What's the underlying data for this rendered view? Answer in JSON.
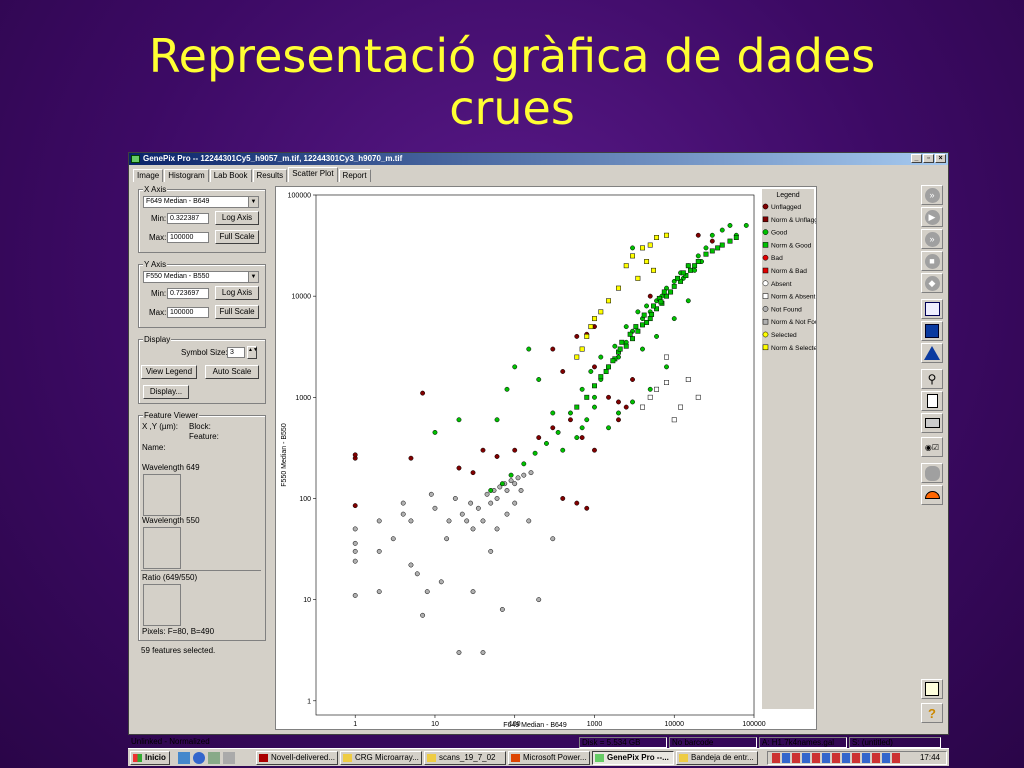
{
  "slide": {
    "title_line1": "Representació gràfica de dades",
    "title_line2": "crues"
  },
  "window": {
    "title": "GenePix Pro -- 12244301Cy5_h9057_m.tif, 12244301Cy3_h9070_m.tif",
    "min_label": "_",
    "max_label": "▫",
    "close_label": "×"
  },
  "tabs": [
    "Image",
    "Histogram",
    "Lab Book",
    "Results",
    "Scatter Plot",
    "Report"
  ],
  "active_tab": "Scatter Plot",
  "x_axis_group": {
    "label": "X Axis",
    "select": "F649 Median - B649",
    "min_label": "Min:",
    "min_value": "0.322387",
    "max_label": "Max:",
    "max_value": "100000",
    "log_btn": "Log Axis",
    "full_btn": "Full Scale"
  },
  "y_axis_group": {
    "label": "Y Axis",
    "select": "F550 Median - B550",
    "min_label": "Min:",
    "min_value": "0.723697",
    "max_label": "Max:",
    "max_value": "100000",
    "log_btn": "Log Axis",
    "full_btn": "Full Scale"
  },
  "display_group": {
    "label": "Display",
    "symbol_label": "Symbol Size:",
    "symbol_value": "3",
    "view_legend": "View Legend",
    "auto_scale": "Auto Scale",
    "display_btn": "Display..."
  },
  "feature_viewer": {
    "label": "Feature Viewer",
    "xy": "X ,Y (µm):",
    "block": "Block:",
    "feature": "Feature:",
    "name": "Name:",
    "wl649": "Wavelength 649",
    "wl550": "Wavelength 550",
    "ratio": "Ratio (649/550)",
    "pixels": "Pixels: F=80, B=490"
  },
  "selected_text": "59 features selected.",
  "legend": {
    "title": "Legend",
    "items": [
      {
        "label": "Unflagged",
        "shape": "circle",
        "color": "#800000"
      },
      {
        "label": "Norm & Unflagged",
        "shape": "square",
        "color": "#800000"
      },
      {
        "label": "Good",
        "shape": "circle",
        "color": "#00c000"
      },
      {
        "label": "Norm & Good",
        "shape": "square",
        "color": "#00c000"
      },
      {
        "label": "Bad",
        "shape": "circle",
        "color": "#e00000"
      },
      {
        "label": "Norm & Bad",
        "shape": "square",
        "color": "#e00000"
      },
      {
        "label": "Absent",
        "shape": "circle",
        "color": "#ffffff"
      },
      {
        "label": "Norm & Absent",
        "shape": "square",
        "color": "#ffffff"
      },
      {
        "label": "Not Found",
        "shape": "circle",
        "color": "#b0b0b0"
      },
      {
        "label": "Norm & Not Found",
        "shape": "square",
        "color": "#b0b0b0"
      },
      {
        "label": "Selected",
        "shape": "circle",
        "color": "#ffff00"
      },
      {
        "label": "Norm & Selected",
        "shape": "square",
        "color": "#ffff00"
      }
    ]
  },
  "chart_data": {
    "type": "scatter",
    "xlabel": "F649 Median - B649",
    "ylabel": "F550 Median - B550",
    "x_scale": "log",
    "y_scale": "log",
    "xlim": [
      0.322387,
      100000
    ],
    "ylim": [
      0.723697,
      100000
    ],
    "x_ticks": [
      "1",
      "10",
      "100",
      "1000",
      "10000",
      "100000"
    ],
    "y_ticks": [
      "1",
      "10",
      "100",
      "1000",
      "10000",
      "100000"
    ],
    "grid": true,
    "legend_position": "right",
    "series": [
      {
        "name": "Not Found",
        "points": [
          [
            1,
            11
          ],
          [
            1,
            24
          ],
          [
            1,
            30
          ],
          [
            1,
            36
          ],
          [
            1,
            50
          ],
          [
            2,
            12
          ],
          [
            2,
            60
          ],
          [
            2,
            30
          ],
          [
            3,
            40
          ],
          [
            4,
            70
          ],
          [
            4,
            90
          ],
          [
            5,
            60
          ],
          [
            5,
            22
          ],
          [
            6,
            18
          ],
          [
            7,
            7
          ],
          [
            8,
            12
          ],
          [
            9,
            110
          ],
          [
            10,
            80
          ],
          [
            12,
            15
          ],
          [
            14,
            40
          ],
          [
            20,
            3
          ],
          [
            25,
            60
          ],
          [
            30,
            12
          ],
          [
            40,
            3
          ],
          [
            50,
            30
          ],
          [
            60,
            50
          ],
          [
            70,
            8
          ],
          [
            80,
            70
          ],
          [
            100,
            90
          ],
          [
            150,
            60
          ],
          [
            200,
            10
          ],
          [
            300,
            40
          ],
          [
            15,
            60
          ],
          [
            18,
            100
          ],
          [
            22,
            70
          ],
          [
            28,
            90
          ],
          [
            35,
            80
          ],
          [
            45,
            110
          ],
          [
            55,
            120
          ],
          [
            65,
            130
          ],
          [
            75,
            140
          ],
          [
            90,
            150
          ],
          [
            110,
            160
          ],
          [
            130,
            170
          ],
          [
            160,
            180
          ],
          [
            60,
            100
          ],
          [
            80,
            120
          ],
          [
            100,
            140
          ],
          [
            120,
            120
          ],
          [
            40,
            60
          ],
          [
            30,
            50
          ],
          [
            50,
            90
          ]
        ],
        "color": "#b0b0b0",
        "shape": "circle"
      },
      {
        "name": "Unflagged",
        "points": [
          [
            1,
            250
          ],
          [
            1,
            270
          ],
          [
            1,
            85
          ],
          [
            7,
            1100
          ],
          [
            5,
            250
          ],
          [
            20,
            200
          ],
          [
            30,
            180
          ],
          [
            40,
            300
          ],
          [
            60,
            260
          ],
          [
            100,
            300
          ],
          [
            200,
            400
          ],
          [
            300,
            500
          ],
          [
            500,
            600
          ],
          [
            700,
            400
          ],
          [
            1000,
            300
          ],
          [
            2000,
            600
          ],
          [
            3000,
            1500
          ],
          [
            1000,
            2000
          ],
          [
            400,
            1800
          ],
          [
            300,
            3000
          ],
          [
            600,
            4000
          ],
          [
            800,
            4200
          ],
          [
            1000,
            5000
          ],
          [
            1500,
            1000
          ],
          [
            2000,
            900
          ],
          [
            2500,
            800
          ],
          [
            400,
            100
          ],
          [
            600,
            90
          ],
          [
            800,
            80
          ],
          [
            5000,
            10000
          ],
          [
            20000,
            40000
          ],
          [
            30000,
            35000
          ]
        ],
        "color": "#800000",
        "shape": "circle"
      },
      {
        "name": "Good",
        "points": [
          [
            20,
            600
          ],
          [
            10,
            450
          ],
          [
            60,
            600
          ],
          [
            80,
            1200
          ],
          [
            100,
            2000
          ],
          [
            150,
            3000
          ],
          [
            200,
            1500
          ],
          [
            300,
            700
          ],
          [
            400,
            300
          ],
          [
            600,
            400
          ],
          [
            800,
            600
          ],
          [
            1000,
            1000
          ],
          [
            1200,
            1500
          ],
          [
            1500,
            2000
          ],
          [
            2000,
            2500
          ],
          [
            2500,
            3500
          ],
          [
            3000,
            4500
          ],
          [
            4000,
            6000
          ],
          [
            5000,
            7000
          ],
          [
            6000,
            9000
          ],
          [
            8000,
            12000
          ],
          [
            10000,
            14000
          ],
          [
            12000,
            17000
          ],
          [
            15000,
            20000
          ],
          [
            20000,
            25000
          ],
          [
            25000,
            30000
          ],
          [
            30000,
            40000
          ],
          [
            40000,
            45000
          ],
          [
            50000,
            50000
          ],
          [
            60000,
            40000
          ],
          [
            80000,
            50000
          ],
          [
            3000,
            30000
          ],
          [
            1000,
            800
          ],
          [
            700,
            500
          ],
          [
            500,
            700
          ],
          [
            350,
            450
          ],
          [
            250,
            350
          ],
          [
            180,
            280
          ],
          [
            130,
            220
          ],
          [
            90,
            170
          ],
          [
            70,
            140
          ],
          [
            50,
            120
          ],
          [
            1500,
            500
          ],
          [
            2000,
            700
          ],
          [
            3000,
            900
          ],
          [
            5000,
            1200
          ],
          [
            8000,
            2000
          ],
          [
            4000,
            3000
          ],
          [
            6000,
            4000
          ],
          [
            10000,
            6000
          ],
          [
            15000,
            9000
          ],
          [
            700,
            1200
          ],
          [
            900,
            1800
          ],
          [
            1200,
            2500
          ],
          [
            1800,
            3200
          ],
          [
            2500,
            5000
          ],
          [
            3500,
            7000
          ],
          [
            4500,
            8000
          ],
          [
            7000,
            10000
          ],
          [
            9000,
            11000
          ],
          [
            13000,
            15000
          ],
          [
            18000,
            18000
          ],
          [
            22000,
            22000
          ]
        ],
        "color": "#00c000",
        "shape": "circle"
      },
      {
        "name": "Norm & Good",
        "points": [
          [
            600,
            800
          ],
          [
            800,
            1000
          ],
          [
            1000,
            1300
          ],
          [
            1200,
            1600
          ],
          [
            1500,
            2000
          ],
          [
            1800,
            2400
          ],
          [
            2000,
            2800
          ],
          [
            2500,
            3200
          ],
          [
            3000,
            3800
          ],
          [
            3500,
            4500
          ],
          [
            4000,
            5200
          ],
          [
            5000,
            6000
          ],
          [
            6000,
            7500
          ],
          [
            7000,
            8500
          ],
          [
            8000,
            10000
          ],
          [
            9000,
            11000
          ],
          [
            10000,
            12500
          ],
          [
            12000,
            14000
          ],
          [
            14000,
            16000
          ],
          [
            16000,
            18000
          ],
          [
            18000,
            20000
          ],
          [
            20000,
            22000
          ],
          [
            25000,
            26000
          ],
          [
            30000,
            28000
          ],
          [
            35000,
            30000
          ],
          [
            40000,
            32000
          ],
          [
            50000,
            35000
          ],
          [
            60000,
            38000
          ],
          [
            2200,
            3500
          ],
          [
            2800,
            4200
          ],
          [
            3300,
            5000
          ],
          [
            4200,
            6500
          ],
          [
            5500,
            8000
          ],
          [
            6500,
            9500
          ],
          [
            7500,
            11000
          ],
          [
            11000,
            15000
          ],
          [
            13000,
            17000
          ],
          [
            15000,
            20000
          ],
          [
            1400,
            1800
          ],
          [
            1700,
            2300
          ],
          [
            2100,
            3000
          ],
          [
            4500,
            5500
          ],
          [
            5200,
            6600
          ],
          [
            6800,
            8800
          ]
        ],
        "color": "#00c000",
        "shape": "square"
      },
      {
        "name": "Norm & Selected",
        "points": [
          [
            3000,
            25000
          ],
          [
            4000,
            30000
          ],
          [
            5000,
            32000
          ],
          [
            6000,
            38000
          ],
          [
            8000,
            40000
          ],
          [
            2500,
            20000
          ],
          [
            2000,
            12000
          ],
          [
            1500,
            9000
          ],
          [
            1200,
            7000
          ],
          [
            1000,
            6000
          ],
          [
            900,
            5000
          ],
          [
            800,
            4000
          ],
          [
            700,
            3000
          ],
          [
            600,
            2500
          ],
          [
            3500,
            15000
          ],
          [
            5500,
            18000
          ],
          [
            4500,
            22000
          ]
        ],
        "color": "#ffff00",
        "shape": "square"
      },
      {
        "name": "Norm & Absent",
        "points": [
          [
            8000,
            1400
          ],
          [
            6000,
            1200
          ],
          [
            5000,
            1000
          ],
          [
            4000,
            800
          ],
          [
            12000,
            800
          ],
          [
            10000,
            600
          ],
          [
            15000,
            1500
          ],
          [
            8000,
            2500
          ],
          [
            20000,
            1000
          ]
        ],
        "color": "#ffffff",
        "shape": "square"
      }
    ]
  },
  "statusbar": {
    "left": "Unlinked - Normalized",
    "disk": "Disk = 5.534 GB",
    "barcode": "No barcode",
    "gal": "A: H1.7k4names.gal",
    "settings": "S: (untitled)"
  },
  "taskbar": {
    "start": "Inicio",
    "tasks": [
      "Novell-delivered...",
      "CRG Microarray...",
      "scans_19_7_02",
      "Microsoft Power...",
      "GenePix Pro --...",
      "Bandeja de entr..."
    ],
    "clock": "17:44"
  }
}
